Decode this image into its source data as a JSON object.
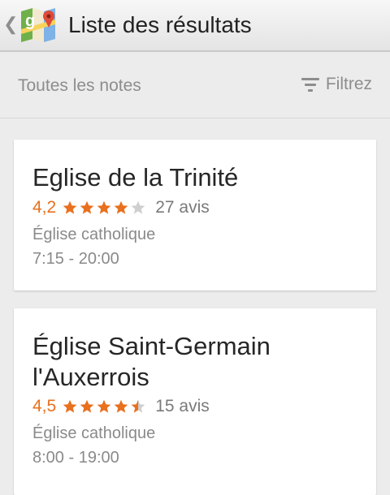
{
  "actionbar": {
    "up_caret": "❮",
    "app_icon": "google-maps-icon",
    "title": "Liste des résultats"
  },
  "filterbar": {
    "sort_label": "Toutes les notes",
    "filter_label": "Filtrez",
    "filter_icon": "filter-icon"
  },
  "colors": {
    "accent_orange": "#e8701e",
    "star_empty": "#cfcfcf"
  },
  "results": [
    {
      "name": "Eglise de la Trinité",
      "rating_text": "4,2",
      "rating_value": 4.2,
      "reviews": "27 avis",
      "category": "Église catholique",
      "hours": "7:15 - 20:00"
    },
    {
      "name": "Église Saint-Germain l'Auxerrois",
      "rating_text": "4,5",
      "rating_value": 4.5,
      "reviews": "15 avis",
      "category": "Église catholique",
      "hours": "8:00 - 19:00"
    }
  ]
}
